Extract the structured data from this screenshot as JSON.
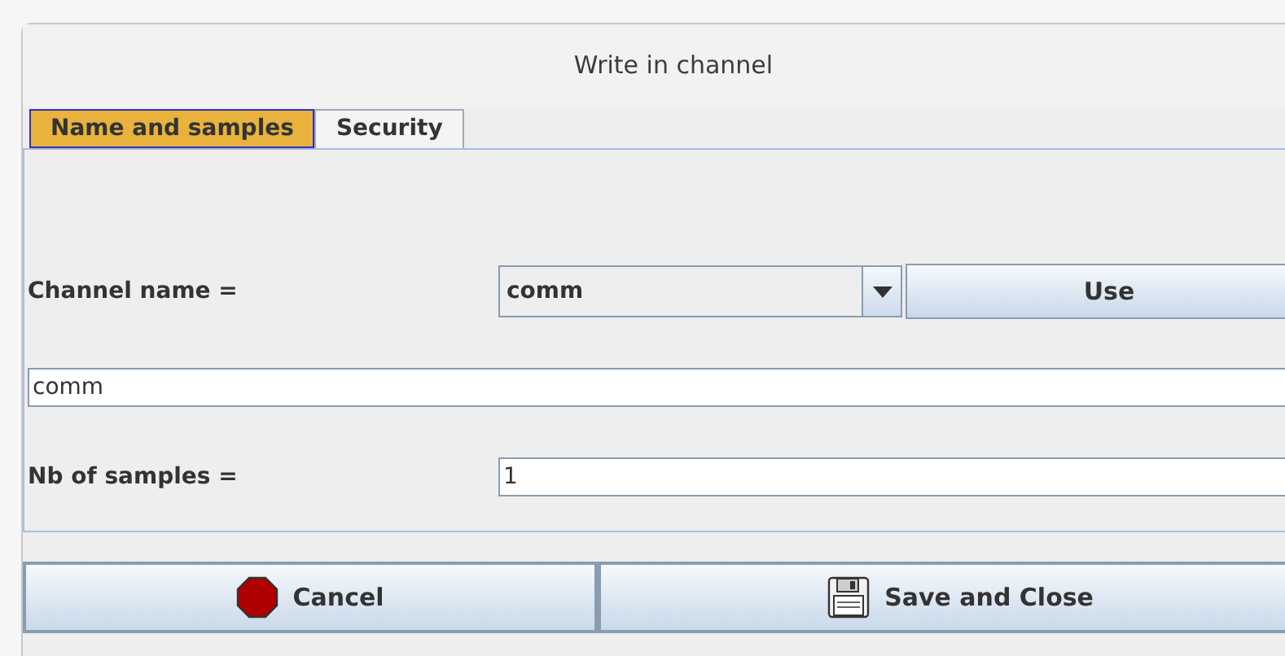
{
  "window": {
    "title": "Write in channel"
  },
  "tabs": [
    {
      "label": "Name and samples",
      "selected": true
    },
    {
      "label": "Security",
      "selected": false
    }
  ],
  "channel_name": {
    "label": "Channel name =",
    "combo_value": "comm",
    "use_button": "Use",
    "text_value": "comm"
  },
  "samples": {
    "label": "Nb of samples =",
    "value": "1"
  },
  "buttons": [
    {
      "kind": "cancel",
      "label": "Cancel"
    },
    {
      "kind": "save",
      "label": "Save and Close"
    }
  ]
}
